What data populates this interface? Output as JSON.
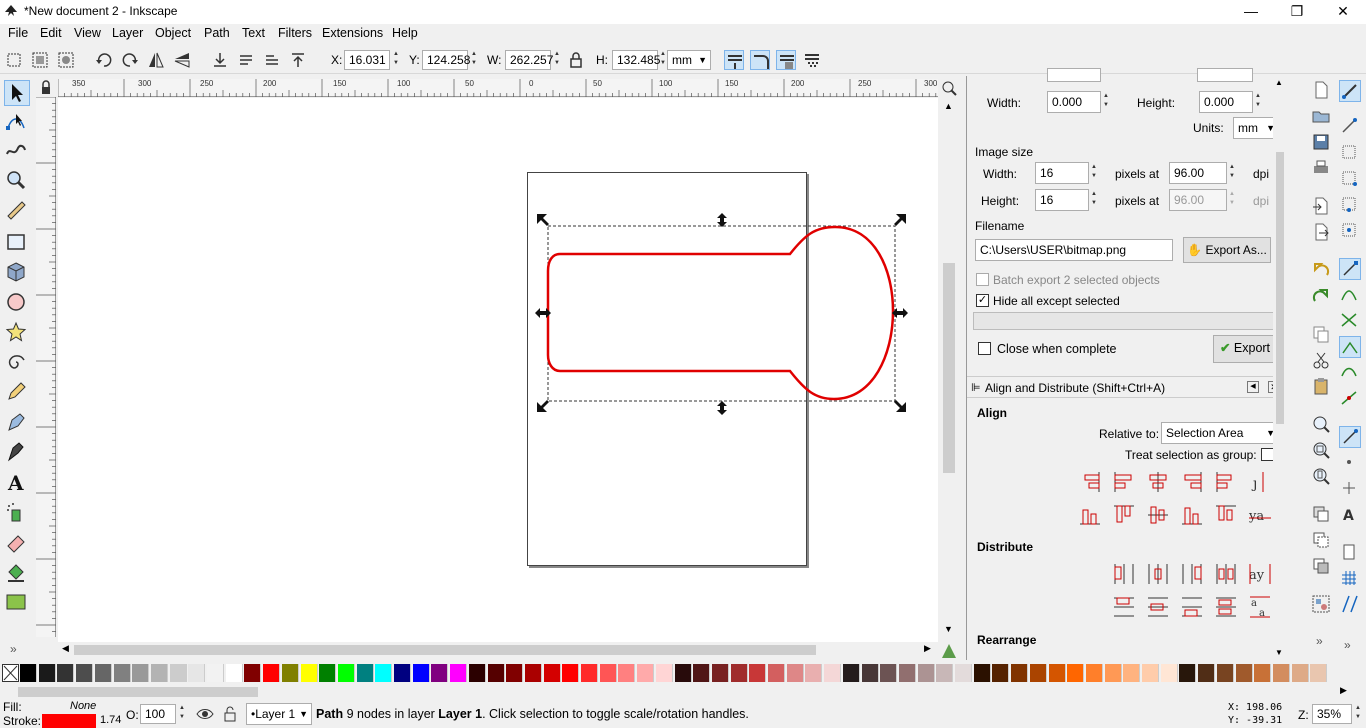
{
  "window": {
    "title": "*New document 2 - Inkscape",
    "minimize": "—",
    "maximize": "❐",
    "close": "✕"
  },
  "menu": [
    "File",
    "Edit",
    "View",
    "Layer",
    "Object",
    "Path",
    "Text",
    "Filters",
    "Extensions",
    "Help"
  ],
  "toolbar": {
    "x_label": "X:",
    "x": "16.031",
    "y_label": "Y:",
    "y": "124.258",
    "w_label": "W:",
    "w": "262.257",
    "h_label": "H:",
    "h": "132.485",
    "unit": "mm"
  },
  "ruler": {
    "h_ticks": [
      "350",
      "300",
      "250",
      "200",
      "150",
      "100",
      "50",
      "0",
      "50",
      "100",
      "150",
      "200",
      "250",
      "300"
    ]
  },
  "export": {
    "width_label": "Width:",
    "width": "0.000",
    "height_label": "Height:",
    "height": "0.000",
    "units_label": "Units:",
    "units": "mm",
    "image_size_title": "Image size",
    "img_width_label": "Width:",
    "img_width": "16",
    "img_height_label": "Height:",
    "img_height": "16",
    "pixels_at": "pixels at",
    "dpi_value": "96.00",
    "dpi_value2": "96.00",
    "dpi": "dpi",
    "filename_title": "Filename",
    "filename": "C:\\Users\\USER\\bitmap.png",
    "export_as": "Export As...",
    "batch_label": "Batch export 2 selected objects",
    "hide_label": "Hide all except selected",
    "close_label": "Close when complete",
    "export_button": "Export"
  },
  "align": {
    "header": "Align and Distribute (Shift+Ctrl+A)",
    "align_title": "Align",
    "relative_label": "Relative to:",
    "relative_value": "Selection Area",
    "treat_label": "Treat selection as group:",
    "distribute_title": "Distribute",
    "rearrange_title": "Rearrange"
  },
  "palette_colors": [
    "#000000",
    "#1a1a1a",
    "#333333",
    "#4d4d4d",
    "#666666",
    "#808080",
    "#999999",
    "#b3b3b3",
    "#cccccc",
    "#e6e6e6",
    "#f2f2f2",
    "#ffffff",
    "#800000",
    "#ff0000",
    "#808000",
    "#ffff00",
    "#008000",
    "#00ff00",
    "#008080",
    "#00ffff",
    "#000080",
    "#0000ff",
    "#800080",
    "#ff00ff",
    "#2b0000",
    "#550000",
    "#800000",
    "#aa0000",
    "#d40000",
    "#ff0000",
    "#ff2a2a",
    "#ff5555",
    "#ff8080",
    "#ffaaaa",
    "#ffd5d5",
    "#280b0b",
    "#501616",
    "#782121",
    "#a02c2c",
    "#c83737",
    "#d35f5f",
    "#de8787",
    "#e9afaf",
    "#f4d7d7",
    "#241c1c",
    "#483737",
    "#6c5353",
    "#916f6f",
    "#ac9393",
    "#c8b7b7",
    "#e3dbdb",
    "#2b1100",
    "#552200",
    "#803300",
    "#aa4400",
    "#d45500",
    "#ff6600",
    "#ff7f2a",
    "#ff9955",
    "#ffb380",
    "#ffccaa",
    "#ffe6d5",
    "#28170b",
    "#502d16",
    "#784421",
    "#a05a2c",
    "#c87137",
    "#d38d5f",
    "#deaa87",
    "#e9c6af"
  ],
  "status": {
    "fill_label": "Fill:",
    "fill_value": "None",
    "stroke_label": "Stroke:",
    "stroke_color": "#ff0000",
    "stroke_width": "1.74",
    "opacity_label": "O:",
    "opacity": "100",
    "layer": "•Layer 1",
    "message_bold": "Path",
    "message": " 9 nodes in layer ",
    "message_layer": "Layer 1",
    "message_end": ". Click selection to toggle scale/rotation handles.",
    "x_readout": "X:  198.06",
    "y_readout": "Y:  -39.31",
    "zoom_label": "Z:",
    "zoom": "35%"
  }
}
